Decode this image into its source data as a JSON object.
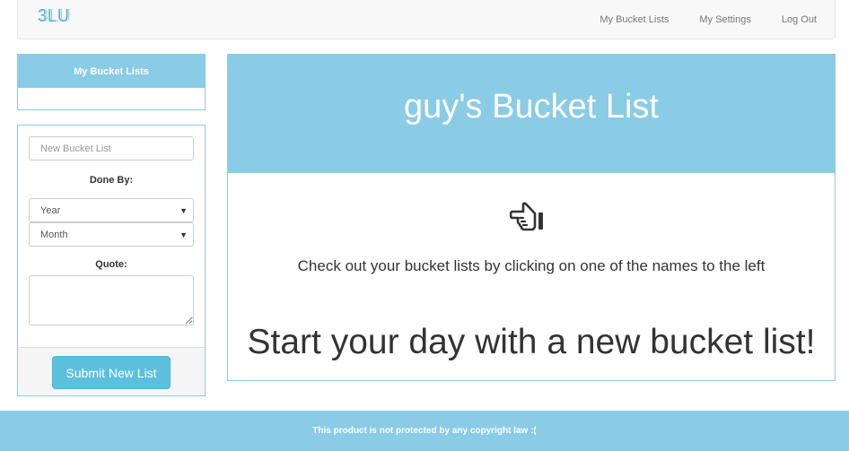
{
  "navbar": {
    "brand": "3LU",
    "links": [
      "My Bucket Lists",
      "My Settings",
      "Log Out"
    ]
  },
  "sidebar": {
    "lists_heading": "My Bucket Lists",
    "form": {
      "name_placeholder": "New Bucket List",
      "done_by_label": "Done By:",
      "year_selected": "Year",
      "month_selected": "Month",
      "quote_label": "Quote:",
      "submit_label": "Submit New List"
    }
  },
  "main": {
    "title": "guy's Bucket List",
    "icon": "hand-pointing-left-icon",
    "hint": "Check out your bucket lists by clicking on one of the names to the left",
    "cta": "Start your day with a new bucket list!"
  },
  "footer": {
    "text": "This product is not protected by any copyright law :("
  },
  "colors": {
    "accent": "#8acbe6",
    "button": "#5bc0de"
  }
}
